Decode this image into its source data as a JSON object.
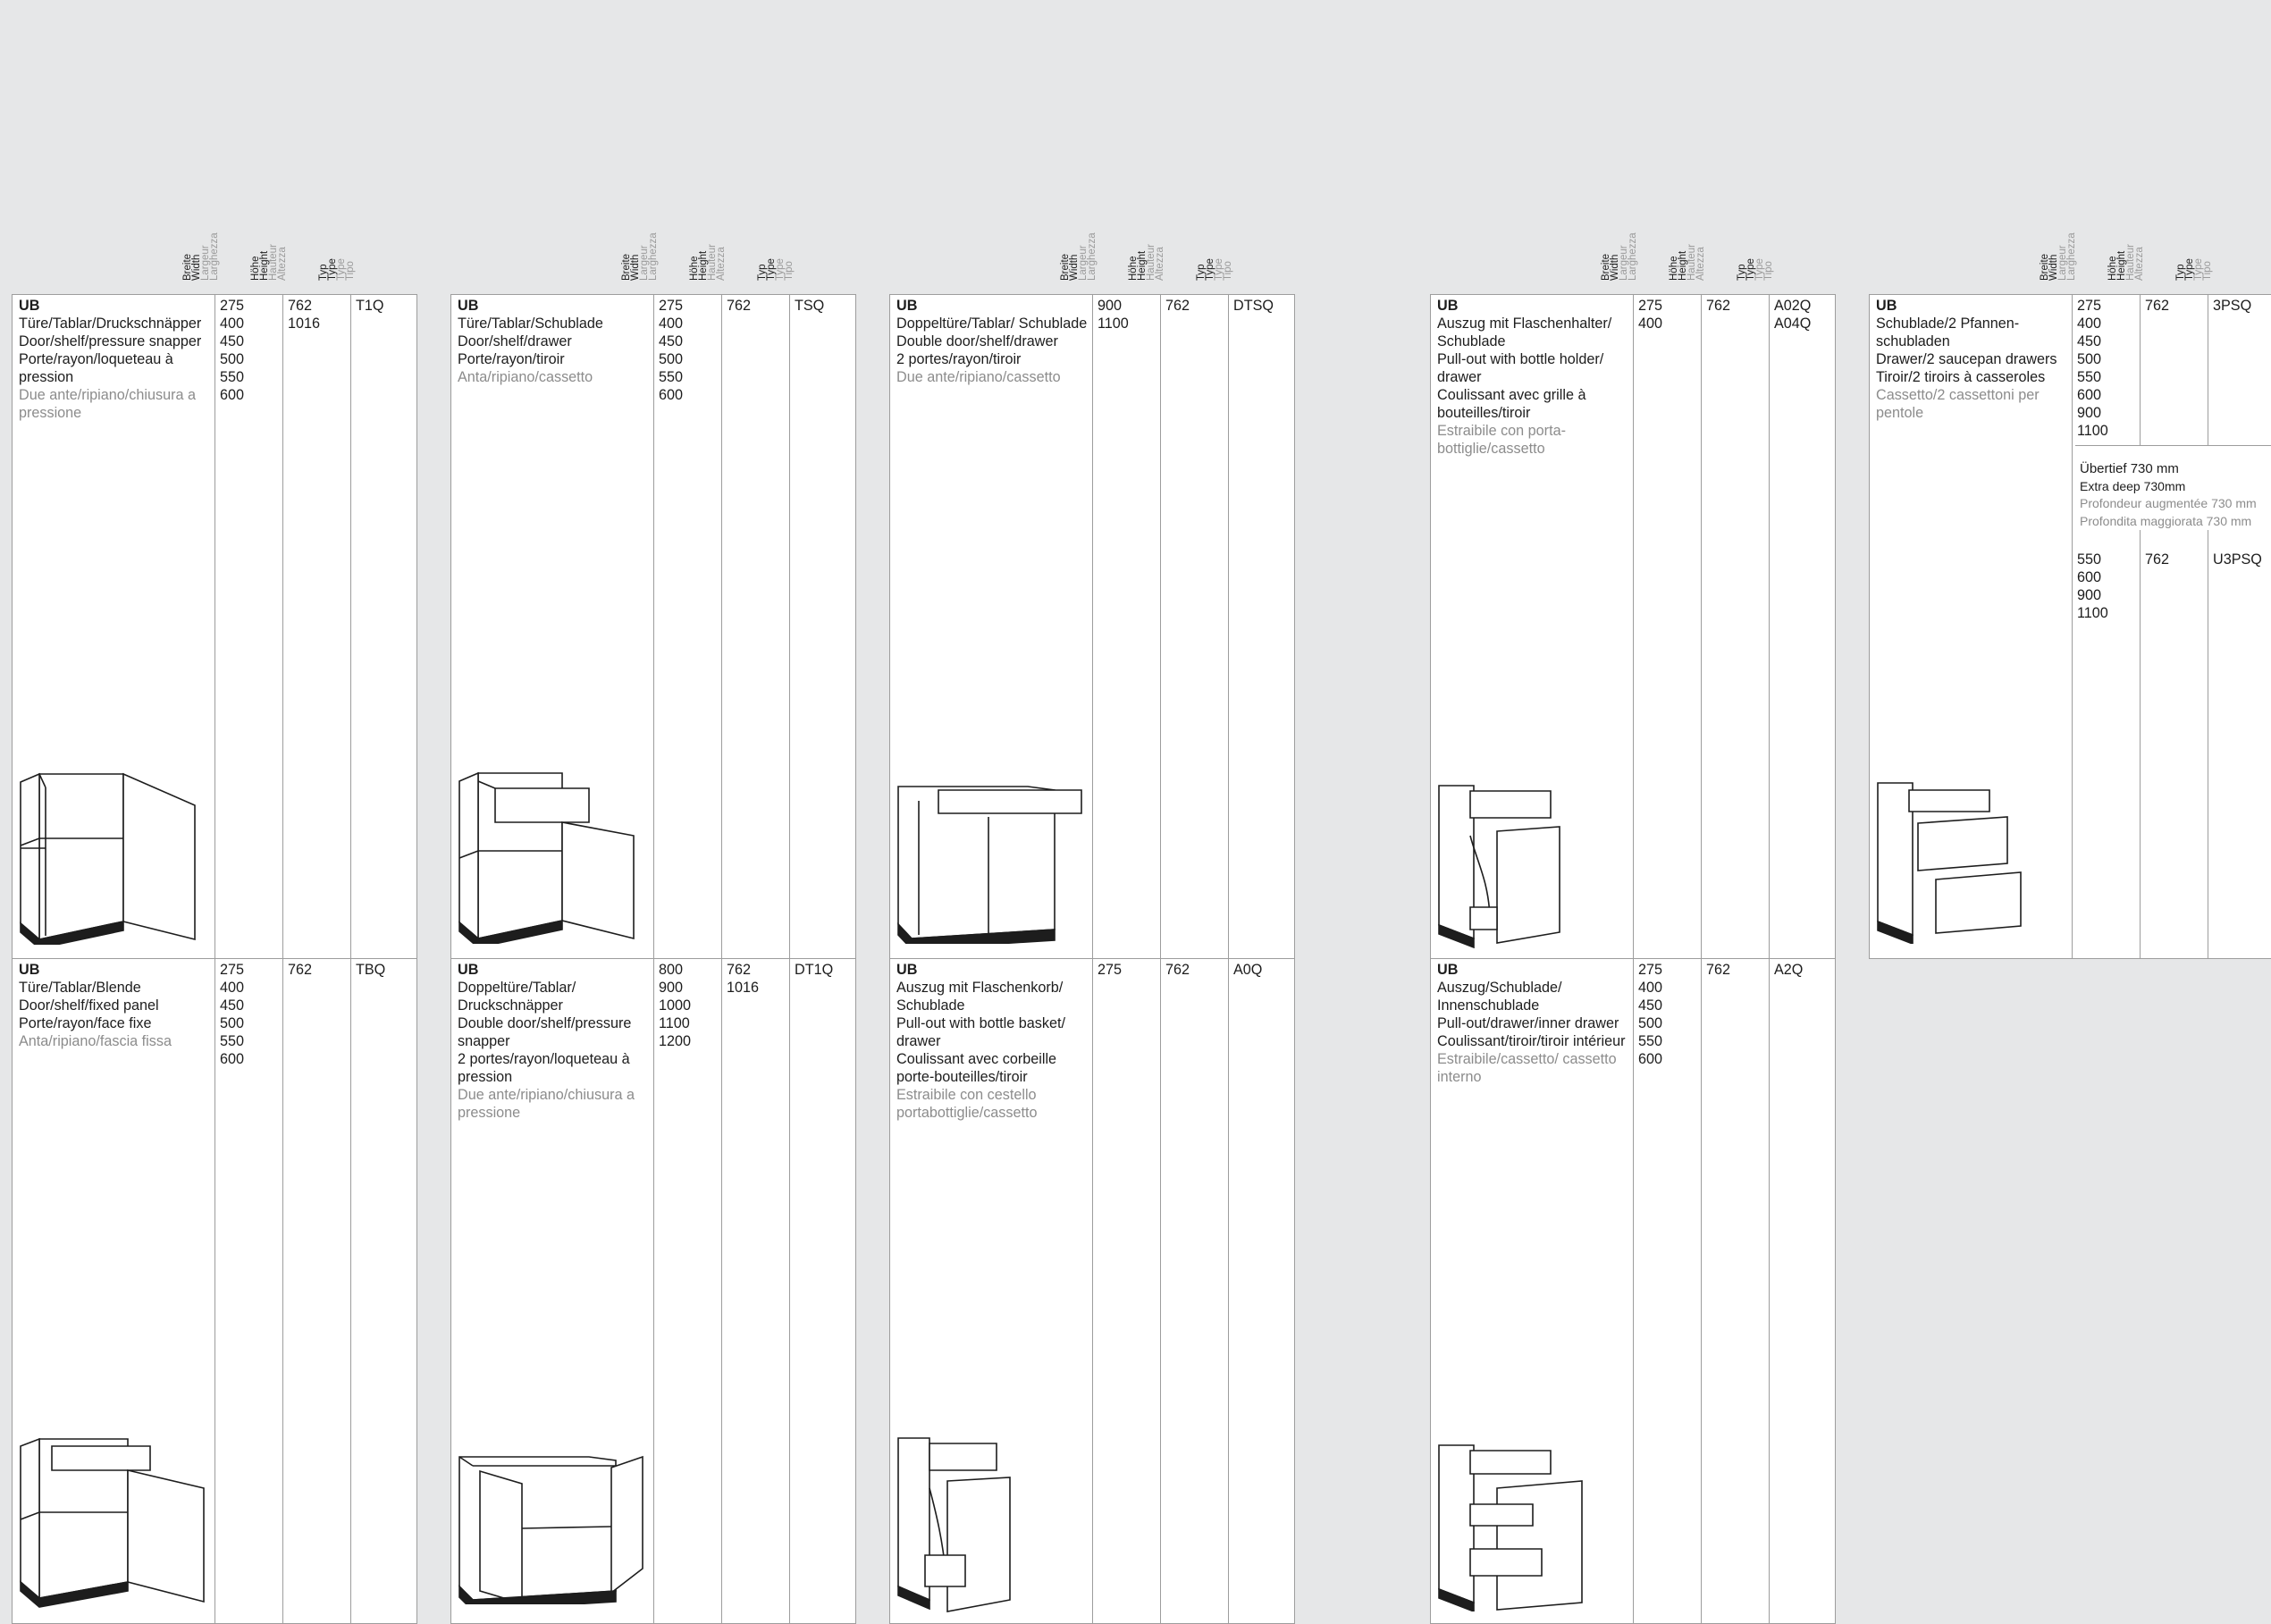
{
  "headers": {
    "width": [
      "Breite",
      "Width",
      "Largeur",
      "Larghezza"
    ],
    "height": [
      "Höhe",
      "Height",
      "Hauteur",
      "Altezza"
    ],
    "type": [
      "Typ",
      "Type",
      "Type",
      "Tipo"
    ]
  },
  "cabinets": [
    {
      "title": "UB",
      "de": "Türe/Tablar/Druckschnäpper",
      "en": "Door/shelf/pressure snapper",
      "fr": "Porte/rayon/loqueteau à pression",
      "it": "Due ante/ripiano/chiusura a pressione",
      "widths": "275\n400\n450\n500\n550\n600",
      "heights": "762\n1016",
      "types": "T1Q",
      "illustration": "door-shelf-cabinet"
    },
    {
      "title": "UB",
      "de": "Türe/Tablar/Schublade",
      "en": "Door/shelf/drawer",
      "fr": "Porte/rayon/tiroir",
      "it": "Anta/ripiano/cassetto",
      "widths": "275\n400\n450\n500\n550\n600",
      "heights": "762",
      "types": "TSQ",
      "illustration": "door-shelf-drawer-cabinet"
    },
    {
      "title": "UB",
      "de": "Doppeltüre/Tablar/ Schublade",
      "en": "Double door/shelf/drawer",
      "fr": "2 portes/rayon/tiroir",
      "it": "Due ante/ripiano/cassetto",
      "widths": "900\n1100",
      "heights": "762",
      "types": "DTSQ",
      "illustration": "double-door-drawer-cabinet"
    },
    {
      "title": "UB",
      "de": "Auszug mit Flaschenhalter/ Schublade",
      "en": "Pull-out with bottle holder/ drawer",
      "fr": "Coulissant avec grille à bouteilles/tiroir",
      "it": "Estraibile con porta- bottiglie/cassetto",
      "widths": "275\n400",
      "heights": "762",
      "types": "A02Q\nA04Q",
      "illustration": "bottle-holder-pullout-cabinet"
    },
    {
      "title": "UB",
      "de": "Schublade/2 Pfannen- schubladen",
      "en": "Drawer/2 saucepan drawers",
      "fr": "Tiroir/2 tiroirs à casseroles",
      "it": "Cassetto/2 cassettoni per pentole",
      "widths": "275\n400\n450\n500\n550\n600\n900\n1100",
      "heights": "762",
      "types": "3PSQ",
      "illustration": "three-drawer-cabinet"
    },
    {
      "title": "UB",
      "de": "Türe/Tablar/Blende",
      "en": "Door/shelf/fixed panel",
      "fr": "Porte/rayon/face fixe",
      "it": "Anta/ripiano/fascia fissa",
      "widths": "275\n400\n450\n500\n550\n600",
      "heights": "762",
      "types": "TBQ",
      "illustration": "door-shelf-panel-cabinet"
    },
    {
      "title": "UB",
      "de": "Doppeltüre/Tablar/ Druckschnäpper",
      "en": "Double door/shelf/pressure snapper",
      "fr": "2 portes/rayon/loqueteau à pression",
      "it": "Due ante/ripiano/chiusura a pressione",
      "widths": "800\n900\n1000\n1100\n1200",
      "heights": "762\n1016",
      "types": "DT1Q",
      "illustration": "double-door-shelf-cabinet"
    },
    {
      "title": "UB",
      "de": "Auszug mit Flaschenkorb/ Schublade",
      "en": "Pull-out with bottle basket/ drawer",
      "fr": "Coulissant avec corbeille porte-bouteilles/tiroir",
      "it": "Estraibile con cestello portabottiglie/cassetto",
      "widths": "275",
      "heights": "762",
      "types": "A0Q",
      "illustration": "bottle-basket-pullout-cabinet"
    },
    {
      "title": "UB",
      "de": "Auszug/Schublade/ Innenschublade",
      "en": "Pull-out/drawer/inner drawer",
      "fr": "Coulissant/tiroir/tiroir intérieur",
      "it": "Estraibile/cassetto/ cassetto interno",
      "widths": "275\n400\n450\n500\n550\n600",
      "heights": "762",
      "types": "A2Q",
      "illustration": "pullout-inner-drawer-cabinet"
    }
  ],
  "extra_deep": {
    "de": "Übertief 730 mm",
    "en": "Extra deep 730mm",
    "fr": "Profondeur augmentée 730 mm",
    "it": "Profondita maggiorata 730 mm",
    "widths": "550\n600\n900\n1100",
    "heights": "762",
    "types": "U3PSQ"
  }
}
